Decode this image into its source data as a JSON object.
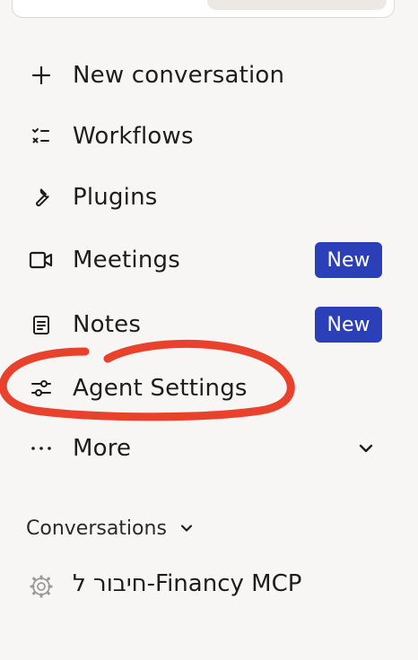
{
  "nav": {
    "items": [
      {
        "label": "New conversation",
        "icon": "plus-icon"
      },
      {
        "label": "Workflows",
        "icon": "checklist-icon"
      },
      {
        "label": "Plugins",
        "icon": "wrench-icon"
      },
      {
        "label": "Meetings",
        "icon": "video-camera-icon",
        "badge": "New"
      },
      {
        "label": "Notes",
        "icon": "note-icon",
        "badge": "New"
      },
      {
        "label": "Agent Settings",
        "icon": "sliders-icon"
      },
      {
        "label": "More",
        "icon": "ellipsis-icon"
      }
    ]
  },
  "conversations": {
    "header": "Conversations",
    "items": [
      {
        "label": "חיבור ל-Financy MCP",
        "icon": "gear-icon"
      }
    ]
  },
  "colors": {
    "background": "#f8f6f4",
    "badge": "#2b3fb8",
    "annotation": "#e8412c"
  }
}
